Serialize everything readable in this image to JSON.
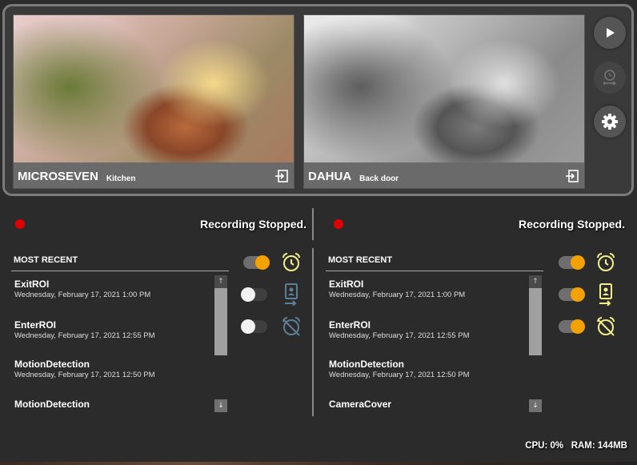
{
  "cameras": [
    {
      "name": "MICROSEVEN",
      "location": "Kitchen"
    },
    {
      "name": "DAHUA",
      "location": "Back door"
    }
  ],
  "controls": {
    "play_icon": "play-icon",
    "timer_icon": "timer-icon",
    "settings_icon": "gear-icon"
  },
  "panels": [
    {
      "status": "Recording Stopped.",
      "header": "MOST RECENT",
      "events": [
        {
          "title": "ExitROI",
          "date": "Wednesday, February 17, 2021 1:00 PM"
        },
        {
          "title": "EnterROI",
          "date": "Wednesday, February 17, 2021 12:55 PM"
        },
        {
          "title": "MotionDetection",
          "date": "Wednesday, February 17, 2021 12:50 PM"
        },
        {
          "title": "MotionDetection",
          "date": ""
        }
      ],
      "toggles": [
        true,
        false,
        false
      ]
    },
    {
      "status": "Recording Stopped.",
      "header": "MOST RECENT",
      "events": [
        {
          "title": "ExitROI",
          "date": "Wednesday, February 17, 2021 1:00 PM"
        },
        {
          "title": "EnterROI",
          "date": "Wednesday, February 17, 2021 12:55 PM"
        },
        {
          "title": "MotionDetection",
          "date": "Wednesday, February 17, 2021 12:50 PM"
        },
        {
          "title": "CameraCover",
          "date": ""
        }
      ],
      "toggles": [
        true,
        true,
        true
      ]
    }
  ],
  "system": {
    "stats": "CPU: 0%   RAM: 144MB"
  },
  "colors": {
    "accent": "#f5a200",
    "status_dot": "#e00000",
    "icon_glow": "#f3f08a"
  }
}
